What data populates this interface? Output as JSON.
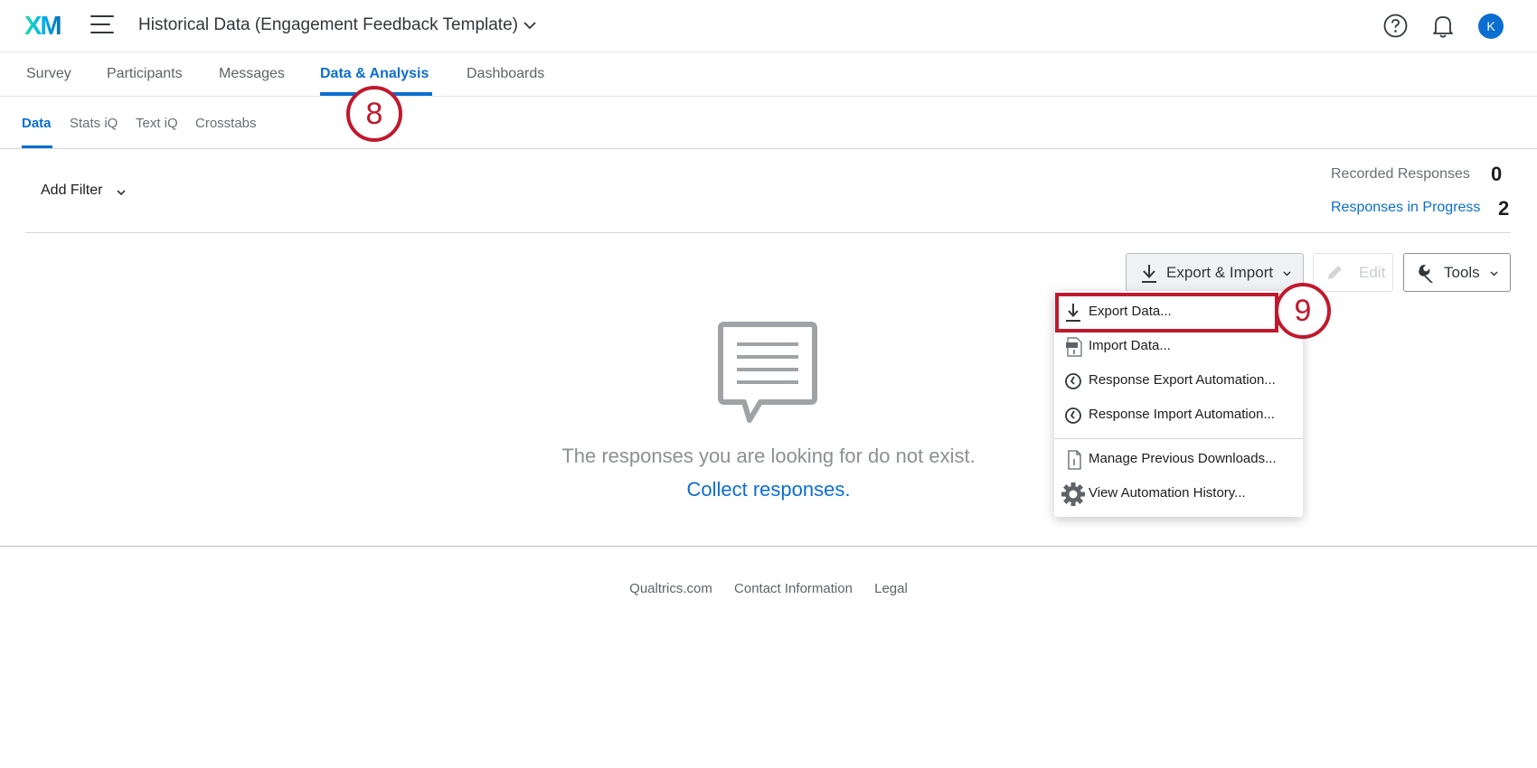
{
  "header": {
    "logo_text": "XM",
    "project_title": "Historical Data (Engagement Feedback Template)",
    "avatar_initial": "K"
  },
  "tabs": [
    {
      "label": "Survey"
    },
    {
      "label": "Participants"
    },
    {
      "label": "Messages"
    },
    {
      "label": "Data & Analysis",
      "active": true
    },
    {
      "label": "Dashboards"
    }
  ],
  "subtabs": [
    {
      "label": "Data",
      "active": true
    },
    {
      "label": "Stats iQ"
    },
    {
      "label": "Text iQ"
    },
    {
      "label": "Crosstabs"
    }
  ],
  "steps": {
    "first": "8",
    "second": "9"
  },
  "filter": {
    "add_filter_label": "Add Filter"
  },
  "responses": {
    "recorded_label": "Recorded Responses",
    "recorded_count": "0",
    "in_progress_label": "Responses in Progress",
    "in_progress_count": "2"
  },
  "toolbar": {
    "export_import_label": "Export & Import",
    "edit_label": "Edit",
    "tools_label": "Tools"
  },
  "dropdown": {
    "items": [
      {
        "label": "Export Data...",
        "icon": "download-icon"
      },
      {
        "label": "Import Data...",
        "icon": "csv-file-icon"
      },
      {
        "label": "Response Export Automation...",
        "icon": "clock-icon"
      },
      {
        "label": "Response Import Automation...",
        "icon": "clock-icon"
      },
      {
        "label": "Manage Previous Downloads...",
        "icon": "document-icon"
      },
      {
        "label": "View Automation History...",
        "icon": "gear-icon"
      }
    ]
  },
  "empty_state": {
    "icon": "speech-bubble-icon",
    "message": "The responses you are looking for do not exist.",
    "link": "Collect responses."
  },
  "footer": {
    "links": [
      "Qualtrics.com",
      "Contact Information",
      "Legal"
    ]
  },
  "colors": {
    "accent": "#0b6ed0",
    "step_marker": "#c0192d",
    "text": "#32363a"
  }
}
